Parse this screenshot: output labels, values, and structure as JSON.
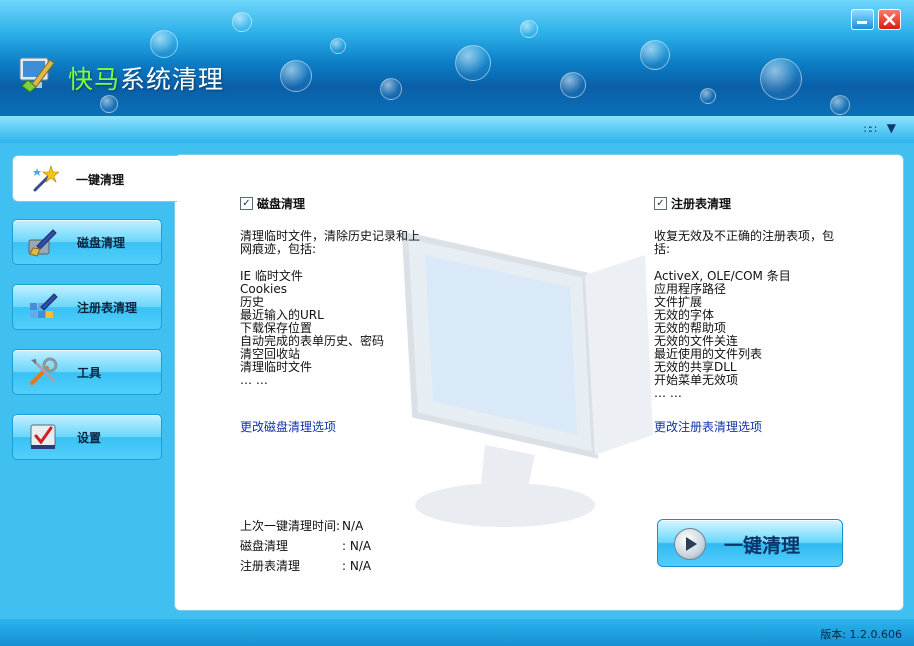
{
  "app": {
    "title_brand": "快马",
    "title_rest": "系统清理"
  },
  "nav": {
    "active_tab": "一键清理",
    "items": [
      {
        "label": "磁盘清理",
        "icon": "broom-disk-icon"
      },
      {
        "label": "注册表清理",
        "icon": "registry-broom-icon"
      },
      {
        "label": "工具",
        "icon": "tools-icon"
      },
      {
        "label": "设置",
        "icon": "settings-icon"
      }
    ]
  },
  "disk": {
    "checkbox_label": "磁盘清理",
    "checked": true,
    "desc_line1": "清理临时文件，清除历史记录和上",
    "desc_line2": "网痕迹，包括:",
    "items": [
      "IE 临时文件",
      "Cookies",
      "历史",
      "最近输入的URL",
      "下载保存位置",
      "自动完成的表单历史、密码",
      "清空回收站",
      "清理临时文件",
      "… …"
    ],
    "link": "更改磁盘清理选项"
  },
  "registry": {
    "checkbox_label": "注册表清理",
    "checked": true,
    "desc_line1": "收复无效及不正确的注册表项，包",
    "desc_line2": "括:",
    "items": [
      "ActiveX, OLE/COM 条目",
      "应用程序路径",
      "文件扩展",
      "无效的字体",
      "无效的帮助项",
      "无效的文件关连",
      "最近使用的文件列表",
      "无效的共享DLL",
      "开始菜单无效项",
      "… …"
    ],
    "link": "更改注册表清理选项"
  },
  "stats": {
    "last_clean_label": "上次一键清理时间:",
    "last_clean_value": "N/A",
    "disk_label": "磁盘清理",
    "disk_value": ": N/A",
    "reg_label": "注册表清理",
    "reg_value": ": N/A"
  },
  "action": {
    "one_click_label": "一键清理"
  },
  "status": {
    "version": "版本: 1.2.0.606"
  },
  "colors": {
    "accent": "#2cb3ec",
    "brand_green": "#7dff3a",
    "link": "#1233a6"
  }
}
